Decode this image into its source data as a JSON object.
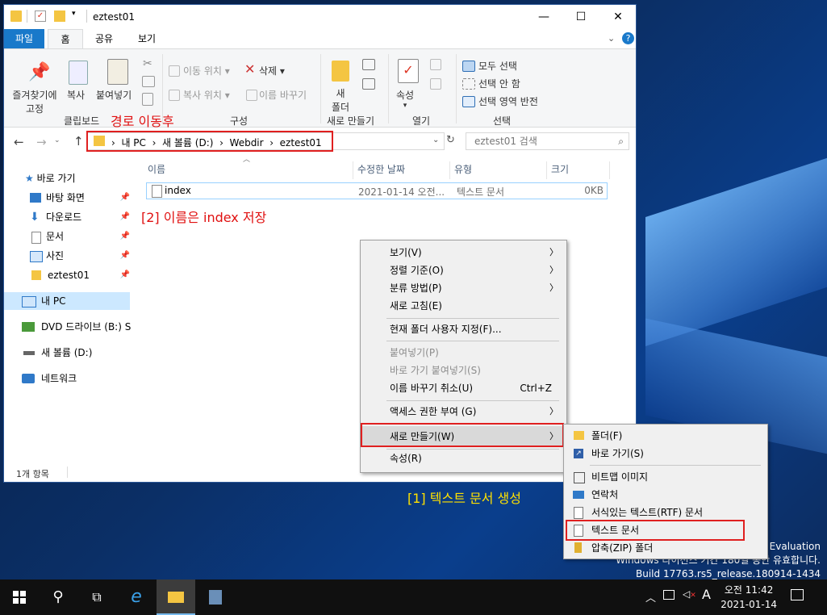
{
  "window": {
    "title": "eztest01",
    "controls": {
      "minimize": "—",
      "maximize": "☐",
      "close": "✕"
    }
  },
  "ribbon_tabs": [
    "파일",
    "홈",
    "공유",
    "보기"
  ],
  "ribbon": {
    "pin_label_1": "즐겨찾기에",
    "pin_label_2": "고정",
    "copy": "복사",
    "paste": "붙여넣기",
    "clipboard_group": "클립보드",
    "move_to": "이동 위치",
    "copy_to": "복사 위치",
    "delete": "삭제",
    "rename": "이름 바꾸기",
    "organize_group": "구성",
    "new_folder_1": "새",
    "new_folder_2": "폴더",
    "new_group": "새로 만들기",
    "properties": "속성",
    "open_group": "열기",
    "select_all": "모두 선택",
    "select_none": "선택 안 함",
    "invert_selection": "선택 영역 반전",
    "select_group": "선택"
  },
  "annotations": {
    "path_note": "경로 이동후",
    "save_note": "[2] 이름은 index 저장",
    "create_note": "[1] 텍스트 문서 생성"
  },
  "address": {
    "crumbs": [
      "내 PC",
      "새 볼륨 (D:)",
      "Webdir",
      "eztest01"
    ],
    "search_placeholder": "eztest01 검색"
  },
  "nav": {
    "quick_access": "바로 가기",
    "items": [
      "바탕 화면",
      "다운로드",
      "문서",
      "사진",
      "eztest01"
    ],
    "this_pc": "내 PC",
    "dvd": "DVD 드라이브 (B:) S",
    "volume": "새 볼륨 (D:)",
    "network": "네트워크"
  },
  "columns": {
    "name": "이름",
    "date": "수정한 날짜",
    "type": "유형",
    "size": "크기"
  },
  "file": {
    "name": "index",
    "date": "2021-01-14 오전...",
    "type": "텍스트 문서",
    "size": "0KB"
  },
  "status": "1개 항목",
  "context_menu": {
    "view": "보기(V)",
    "sort": "정렬 기준(O)",
    "group": "분류 방법(P)",
    "refresh": "새로 고침(E)",
    "customize": "현재 폴더 사용자 지정(F)...",
    "paste": "붙여넣기(P)",
    "paste_shortcut": "바로 가기 붙여넣기(S)",
    "undo_rename": "이름 바꾸기 취소(U)",
    "undo_shortcut": "Ctrl+Z",
    "access": "액세스 권한 부여 (G)",
    "new": "새로 만들기(W)",
    "properties": "속성(R)"
  },
  "submenu": {
    "folder": "폴더(F)",
    "shortcut": "바로 가기(S)",
    "bitmap": "비트맵 이미지",
    "contact": "연락처",
    "rtf": "서식있는 텍스트(RTF) 문서",
    "text": "텍스트 문서",
    "zip": "압축(ZIP) 폴더"
  },
  "watermark": {
    "line1": "d Evaluation",
    "line2": "Windows 라이선스 기간 180일 동안 유효합니다.",
    "line3": "Build 17763.rs5_release.180914-1434"
  },
  "taskbar": {
    "time": "오전 11:42",
    "date": "2021-01-14",
    "ime": "A"
  },
  "colors": {
    "accent": "#1979ca",
    "highlight": "#e02020",
    "selection": "#cce8ff"
  }
}
